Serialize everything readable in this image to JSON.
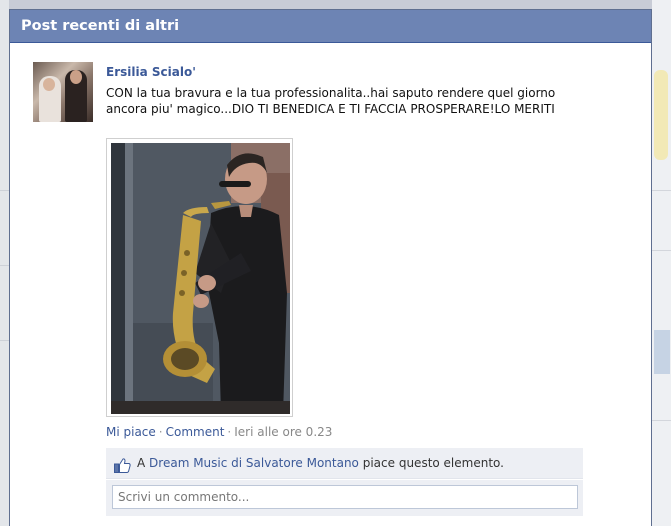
{
  "dialog": {
    "title": "Post recenti di altri"
  },
  "post": {
    "author": "Ersilia Scialo'",
    "message": "CON la tua bravura e la tua professionalita..hai saputo rendere quel giorno ancora piu' magico...DIO TI BENEDICA E TI FACCIA PROSPERARE!LO MERITI",
    "actions": {
      "like_label": "Mi piace",
      "comment_label": "Comment",
      "timestamp": "Ieri alle ore 0.23"
    },
    "likes": {
      "prefix": "A",
      "page_name": "Dream Music di Salvatore Montano",
      "suffix": "piace questo elemento."
    },
    "comment_placeholder": "Scrivi un commento..."
  },
  "icons": {
    "thumb": "thumbs-up-icon"
  },
  "colors": {
    "header_bg": "#6d84b4",
    "link": "#3b5998",
    "likes_bg": "#edeff4"
  }
}
